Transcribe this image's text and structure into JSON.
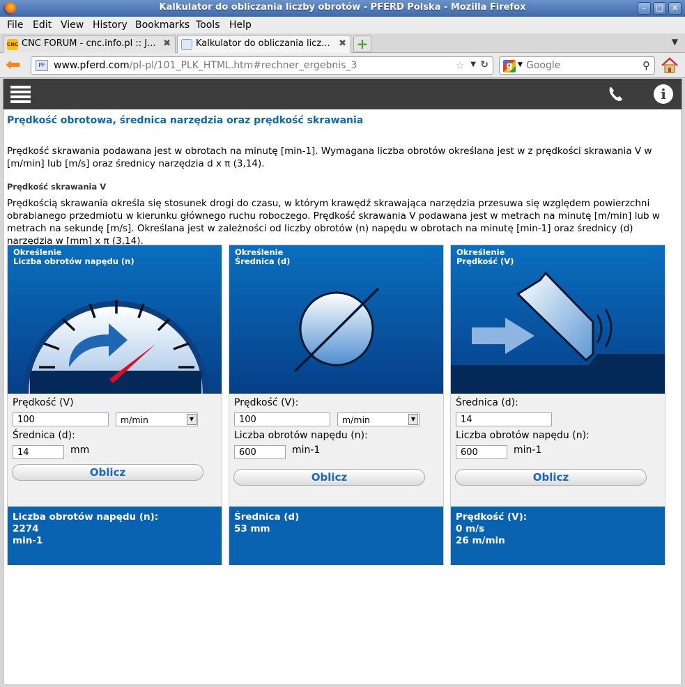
{
  "window": {
    "title": "Kalkulator do obliczania liczby obrotów - PFERD Polska - Mozilla Firefox"
  },
  "menu": [
    "File",
    "Edit",
    "View",
    "History",
    "Bookmarks",
    "Tools",
    "Help"
  ],
  "tabs": [
    {
      "label": "CNC FORUM - cnc.info.pl :: J...",
      "active": false
    },
    {
      "label": "Kalkulator do obliczania licz...",
      "active": true
    }
  ],
  "nav": {
    "url_domain": "www.pferd.com",
    "url_path": "/pl-pl/101_PLK_HTML.htm#rechner_ergebnis_3",
    "search_placeholder": "Google"
  },
  "page": {
    "heading": "Prędkość obrotowa, średnica narzędzia oraz prędkość skrawania",
    "intro": "Prędkość skrawania podawana jest w obrotach na minutę [min-1].  Wymagana liczba obrotów określana jest w z prędkości skrawania V w [m/min] lub [m/s] oraz średnicy narzędzia d x π (3,14).",
    "subheading": "Prędkość skrawania V",
    "para": "Prędkością skrawania określa się stosunek drogi do czasu, w którym krawędź skrawająca narzędzia przesuwa się względem powierzchni obrabianego przedmiotu w kierunku głównego ruchu roboczego.  Prędkość skrawania V podawana jest w metrach na minutę [m/min] lub w metrach na sekundę [m/s].  Określana jest w zależności od liczby obrotów (n) napędu w obrotach na minutę [min-1] oraz średnicy (d) narzędzia  w [mm] x π (3,14)."
  },
  "cards": [
    {
      "cap1": "Określenie",
      "cap2": "Liczba obrotów napędu (n)",
      "label1": "Prędkość (V)",
      "value1": "100",
      "unit_select": "m/min",
      "label2": "Średnica (d):",
      "value2": "14",
      "unit2": "mm",
      "button": "Oblicz",
      "result1": "Liczba obrotów napędu (n):",
      "result2": "2274",
      "result3": "min-1"
    },
    {
      "cap1": "Określenie",
      "cap2": "Średnica (d)",
      "label1": "Prędkość (V):",
      "value1": "100",
      "unit_select": "m/min",
      "label2": "Liczba obrotów napędu (n):",
      "value2": "600",
      "unit2": "min-1",
      "button": "Oblicz",
      "result1": "Średnica (d)",
      "result2": "53 mm",
      "result3": ""
    },
    {
      "cap1": "Określenie",
      "cap2": "Prędkość (V)",
      "label1": "Średnica (d):",
      "value1": "14",
      "label2": "Liczba obrotów napędu (n):",
      "value2": "600",
      "unit2": "min-1",
      "button": "Oblicz",
      "result1": "Prędkość (V):",
      "result2": "0 m/s",
      "result3": "26 m/min"
    }
  ],
  "colors": {
    "brand_blue": "#0a63b0",
    "heading_blue": "#0a67b5",
    "site_bar": "#3d3d3d",
    "needle_red": "#d81020"
  }
}
